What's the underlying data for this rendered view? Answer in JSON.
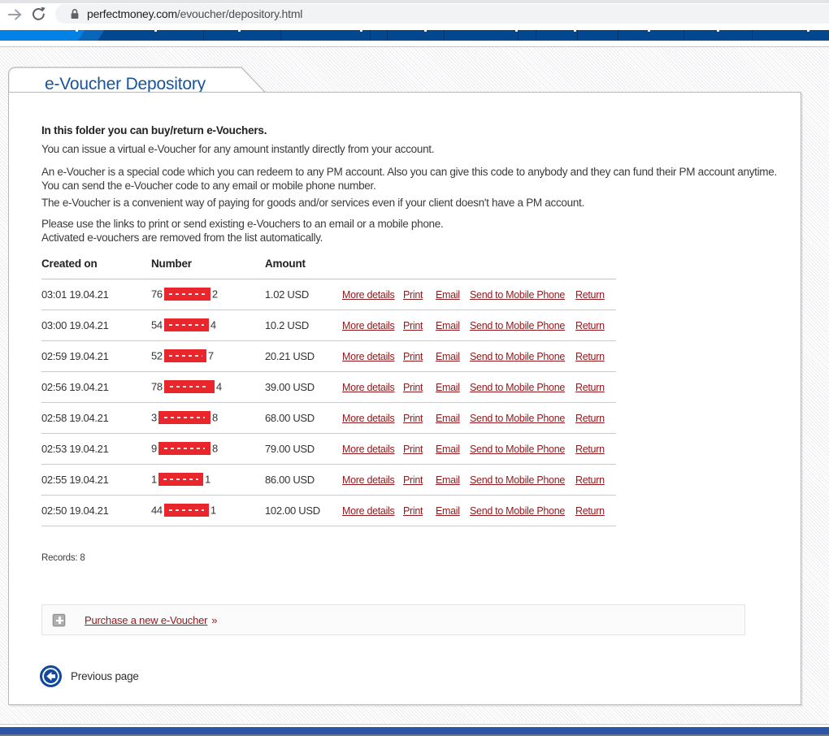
{
  "browser": {
    "url_domain": "perfectmoney.com",
    "url_path": "/evoucher/depository.html",
    "lock_icon": "padlock",
    "forward_icon": "forward-arrow",
    "reload_icon": "reload"
  },
  "page": {
    "title": "e-Voucher Depository",
    "intro": "In this folder you can buy/return e-Vouchers.",
    "paragraphs": [
      "You can issue a virtual e-Voucher for any amount instantly directly from your account.",
      "An e-Voucher is a special code which you can redeem to any PM account. Also you can give this code to anybody and they can fund their PM account anytime.\nYou can send the e-Voucher code to any email or mobile phone number.",
      "The e-Voucher is a convenient way of paying for goods and/or services even if your client doesn't have a PM account.",
      "Please use the links to print or send existing e-Vouchers to an email or a mobile phone.\nActivated e-vouchers are removed from the list automatically."
    ]
  },
  "table": {
    "headers": [
      "Created on",
      "Number",
      "Amount"
    ],
    "action_labels": [
      "More details",
      "Print",
      "Email",
      "Send to Mobile Phone",
      "Return"
    ],
    "rows": [
      {
        "created_on": "03:01 19.04.21",
        "number_prefix": "76",
        "number_suffix": "2",
        "amount": "1.02 USD",
        "redaction_style": "width:57px"
      },
      {
        "created_on": "03:00 19.04.21",
        "number_prefix": "54",
        "number_suffix": "4",
        "amount": "10.2 USD",
        "redaction_style": "width:55px"
      },
      {
        "created_on": "02:59 19.04.21",
        "number_prefix": "52",
        "number_suffix": "7",
        "amount": "20.21 USD",
        "redaction_style": "width:52px"
      },
      {
        "created_on": "02:56 19.04.21",
        "number_prefix": "78",
        "number_suffix": "4",
        "amount": "39.00 USD",
        "redaction_style": "width:62px"
      },
      {
        "created_on": "02:58 19.04.21",
        "number_prefix": "3",
        "number_suffix": "8",
        "amount": "68.00 USD",
        "redaction_style": "width:64px"
      },
      {
        "created_on": "02:53 19.04.21",
        "number_prefix": "9",
        "number_suffix": "8",
        "amount": "79.00 USD",
        "redaction_style": "width:64px"
      },
      {
        "created_on": "02:55 19.04.21",
        "number_prefix": "1",
        "number_suffix": "1",
        "amount": "86.00 USD",
        "redaction_style": "width:55px"
      },
      {
        "created_on": "02:50 19.04.21",
        "number_prefix": "44",
        "number_suffix": "1",
        "amount": "102.00 USD",
        "redaction_style": "width:55px"
      }
    ],
    "records_label": "Records: 8"
  },
  "footer": {
    "purchase_label": "Purchase a new e-Voucher",
    "purchase_arrow": "»",
    "previous_page_label": "Previous page",
    "plus_icon": "plus",
    "back_icon": "left-arrow-circle"
  },
  "colors": {
    "nav_bright_blue": "#0282e4",
    "nav_dark_blue": "#03478f",
    "title_blue": "#17549b",
    "link_maroon": "#8f191c",
    "redaction_red": "#e8262b",
    "bottom_bar_blue": "#2c55a7"
  }
}
